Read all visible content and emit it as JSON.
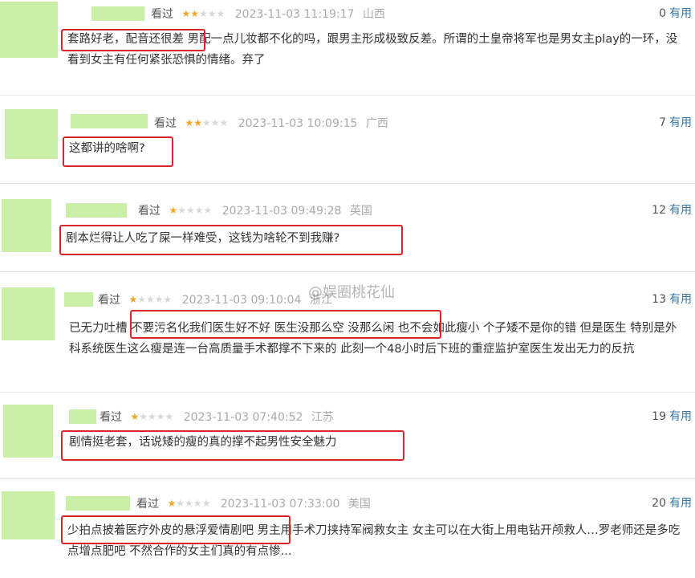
{
  "useful_label": "有用",
  "watched_label": "看过",
  "watermark": "@娱圈桃花仙",
  "reviews": [
    {
      "stars": 2,
      "date": "2023-11-03 11:19:17",
      "location": "山西",
      "useful": "0",
      "highlight": "套路好老，配音还很差",
      "text": " 男配一点儿妆都不化的吗，跟男主形成极致反差。所谓的土皇帝将军也是男女主play的一环，没看到女主有任何紧张恐惧的情绪。弃了"
    },
    {
      "stars": 2,
      "date": "2023-11-03 10:09:15",
      "location": "广西",
      "useful": "7",
      "highlight": "这都讲的啥啊?",
      "text": ""
    },
    {
      "stars": 1,
      "date": "2023-11-03 09:49:28",
      "location": "英国",
      "useful": "12",
      "highlight": "剧本烂得让人吃了屎一样难受，这钱为啥轮不到我赚?",
      "text": ""
    },
    {
      "stars": 1,
      "date": "2023-11-03 09:10:04",
      "location": "浙江",
      "useful": "13",
      "prefix": "已无力吐槽 ",
      "highlight": "不要污名化我们医生好不好 医生没那么空 没那么闲",
      "text": " 也不会如此瘦小 个子矮不是你的错 但是医生 特别是外科系统医生这么瘦是连一台高质量手术都撑不下来的 此刻一个48小时后下班的重症监护室医生发出无力的反抗"
    },
    {
      "stars": 1,
      "date": "2023-11-03 07:40:52",
      "location": "江苏",
      "useful": "19",
      "highlight": "剧情挺老套，话说矮的瘦的真的撑不起男性安全魅力",
      "text": ""
    },
    {
      "stars": 1,
      "date": "2023-11-03 07:33:00",
      "location": "美国",
      "useful": "20",
      "highlight": "少拍点披着医疗外皮的悬浮爱情剧吧",
      "text": " 男主用手术刀挟持军阀救女主 女主可以在大街上用电钻开颅救人…罗老师还是多吃点增点肥吧 不然合作的女主们真的有点惨..."
    }
  ]
}
